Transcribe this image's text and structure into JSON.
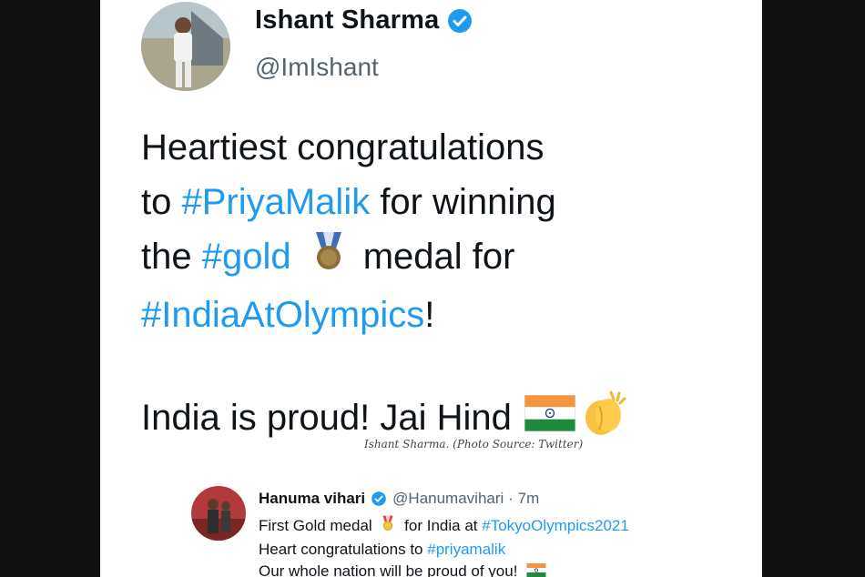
{
  "main_tweet": {
    "name": "Ishant Sharma",
    "handle": "@ImIshant",
    "lines": [
      {
        "pre": "Heartiest congratulations",
        "tag": "",
        "post": ""
      },
      {
        "pre": "to ",
        "tag": "#PriyaMalik",
        "post": " for winning"
      },
      {
        "pre": "the ",
        "tag": "#gold",
        "post": "medal for"
      },
      {
        "pre": "",
        "tag": "#IndiaAtOlympics",
        "post": "!"
      }
    ],
    "closing": "India is proud! Jai Hind"
  },
  "caption": "Ishant Sharma. (Photo Source: Twitter)",
  "reply_tweet": {
    "name": "Hanuma vihari",
    "handle": "@Hanumavihari",
    "time": "· 7m",
    "line1_pre": "First Gold medal",
    "line1_mid": "for India at",
    "line1_tag": "#TokyoOlympics2021",
    "line2_pre": "Heart congratulations to",
    "line2_tag": "#priyamalik",
    "line3": "Our whole nation will be proud of you!"
  },
  "icons": {
    "verified": "verified-badge-icon",
    "medal": "gold-medal-icon",
    "flag": "india-flag-icon",
    "clap": "clapping-hands-icon"
  },
  "colors": {
    "link": "#1d9bf0",
    "text": "#0f1419",
    "muted": "#536471"
  }
}
